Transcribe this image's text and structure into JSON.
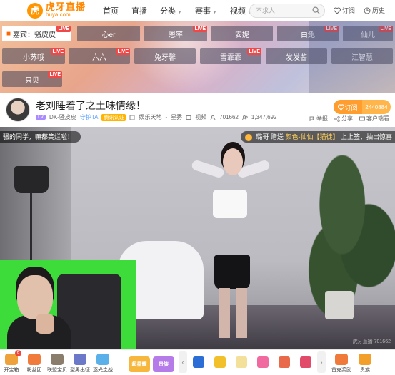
{
  "logo": {
    "cn": "虎牙直播",
    "en": "huya.com",
    "mark": "虎"
  },
  "nav": [
    {
      "label": "首页",
      "caret": false
    },
    {
      "label": "直播",
      "caret": false
    },
    {
      "label": "分类",
      "caret": true
    },
    {
      "label": "赛事",
      "caret": true
    },
    {
      "label": "视频",
      "caret": true
    }
  ],
  "search": {
    "placeholder": "不求人"
  },
  "top_right": {
    "follow_label": "订阅",
    "history_label": "历史"
  },
  "anchors": {
    "first": "嘉宾：骚皮皮",
    "live_badge": "LIVE",
    "items": [
      "心er",
      "恩率",
      "安妮",
      "白兔",
      "仙儿",
      "小苏哦",
      "六六",
      "兔牙馨",
      "雪霏霏",
      "发发酱",
      "江智慧",
      "只贝"
    ]
  },
  "room": {
    "title": "老刘睡着了之土味情缘！",
    "level": "LV",
    "host_name": "DK-骚皮皮",
    "guild": "守护TA",
    "auth_tag": "腾讯认证",
    "category": "娱乐天地",
    "subcategory": "星秀",
    "video_label": "视频",
    "viewers": "701662",
    "fans": "1,347,692",
    "follow_button": "订阅",
    "follow_count": "2440884",
    "actions": [
      "举报",
      "分享",
      "客户端看"
    ]
  },
  "video": {
    "overlay_left": "骚的同学，嘛都笑烂啦！",
    "overlay_right_user": "璐哥",
    "overlay_right_text": "赠送",
    "overlay_right_gift": "颜色-仙仙【猫徒】",
    "overlay_right_tail": "上上签，抽出惊喜",
    "watermark": "虎牙直播 701662"
  },
  "toolbar": {
    "tools": [
      {
        "label": "开宝箱",
        "color": "#f0a23a",
        "badge": "6"
      },
      {
        "label": "粉丝团",
        "color": "#f07b3a",
        "badge": ""
      },
      {
        "label": "联盟宝贝",
        "color": "#8a7d6b",
        "badge": ""
      },
      {
        "label": "型男出征",
        "color": "#6c78c8",
        "badge": ""
      },
      {
        "label": "逐光之战",
        "color": "#5ab0e8",
        "badge": ""
      }
    ],
    "promo1": "超星耀",
    "promo1_color": "#f6b73c",
    "promo2": "贵族",
    "promo2_color": "#b57be8",
    "gifts": [
      "#2b6fd6",
      "#f2c02a",
      "#f3e09a",
      "#f06aa0",
      "#e86a4a",
      "#e24a6a"
    ],
    "first_charge": "首充奖励",
    "noble": "贵族"
  }
}
